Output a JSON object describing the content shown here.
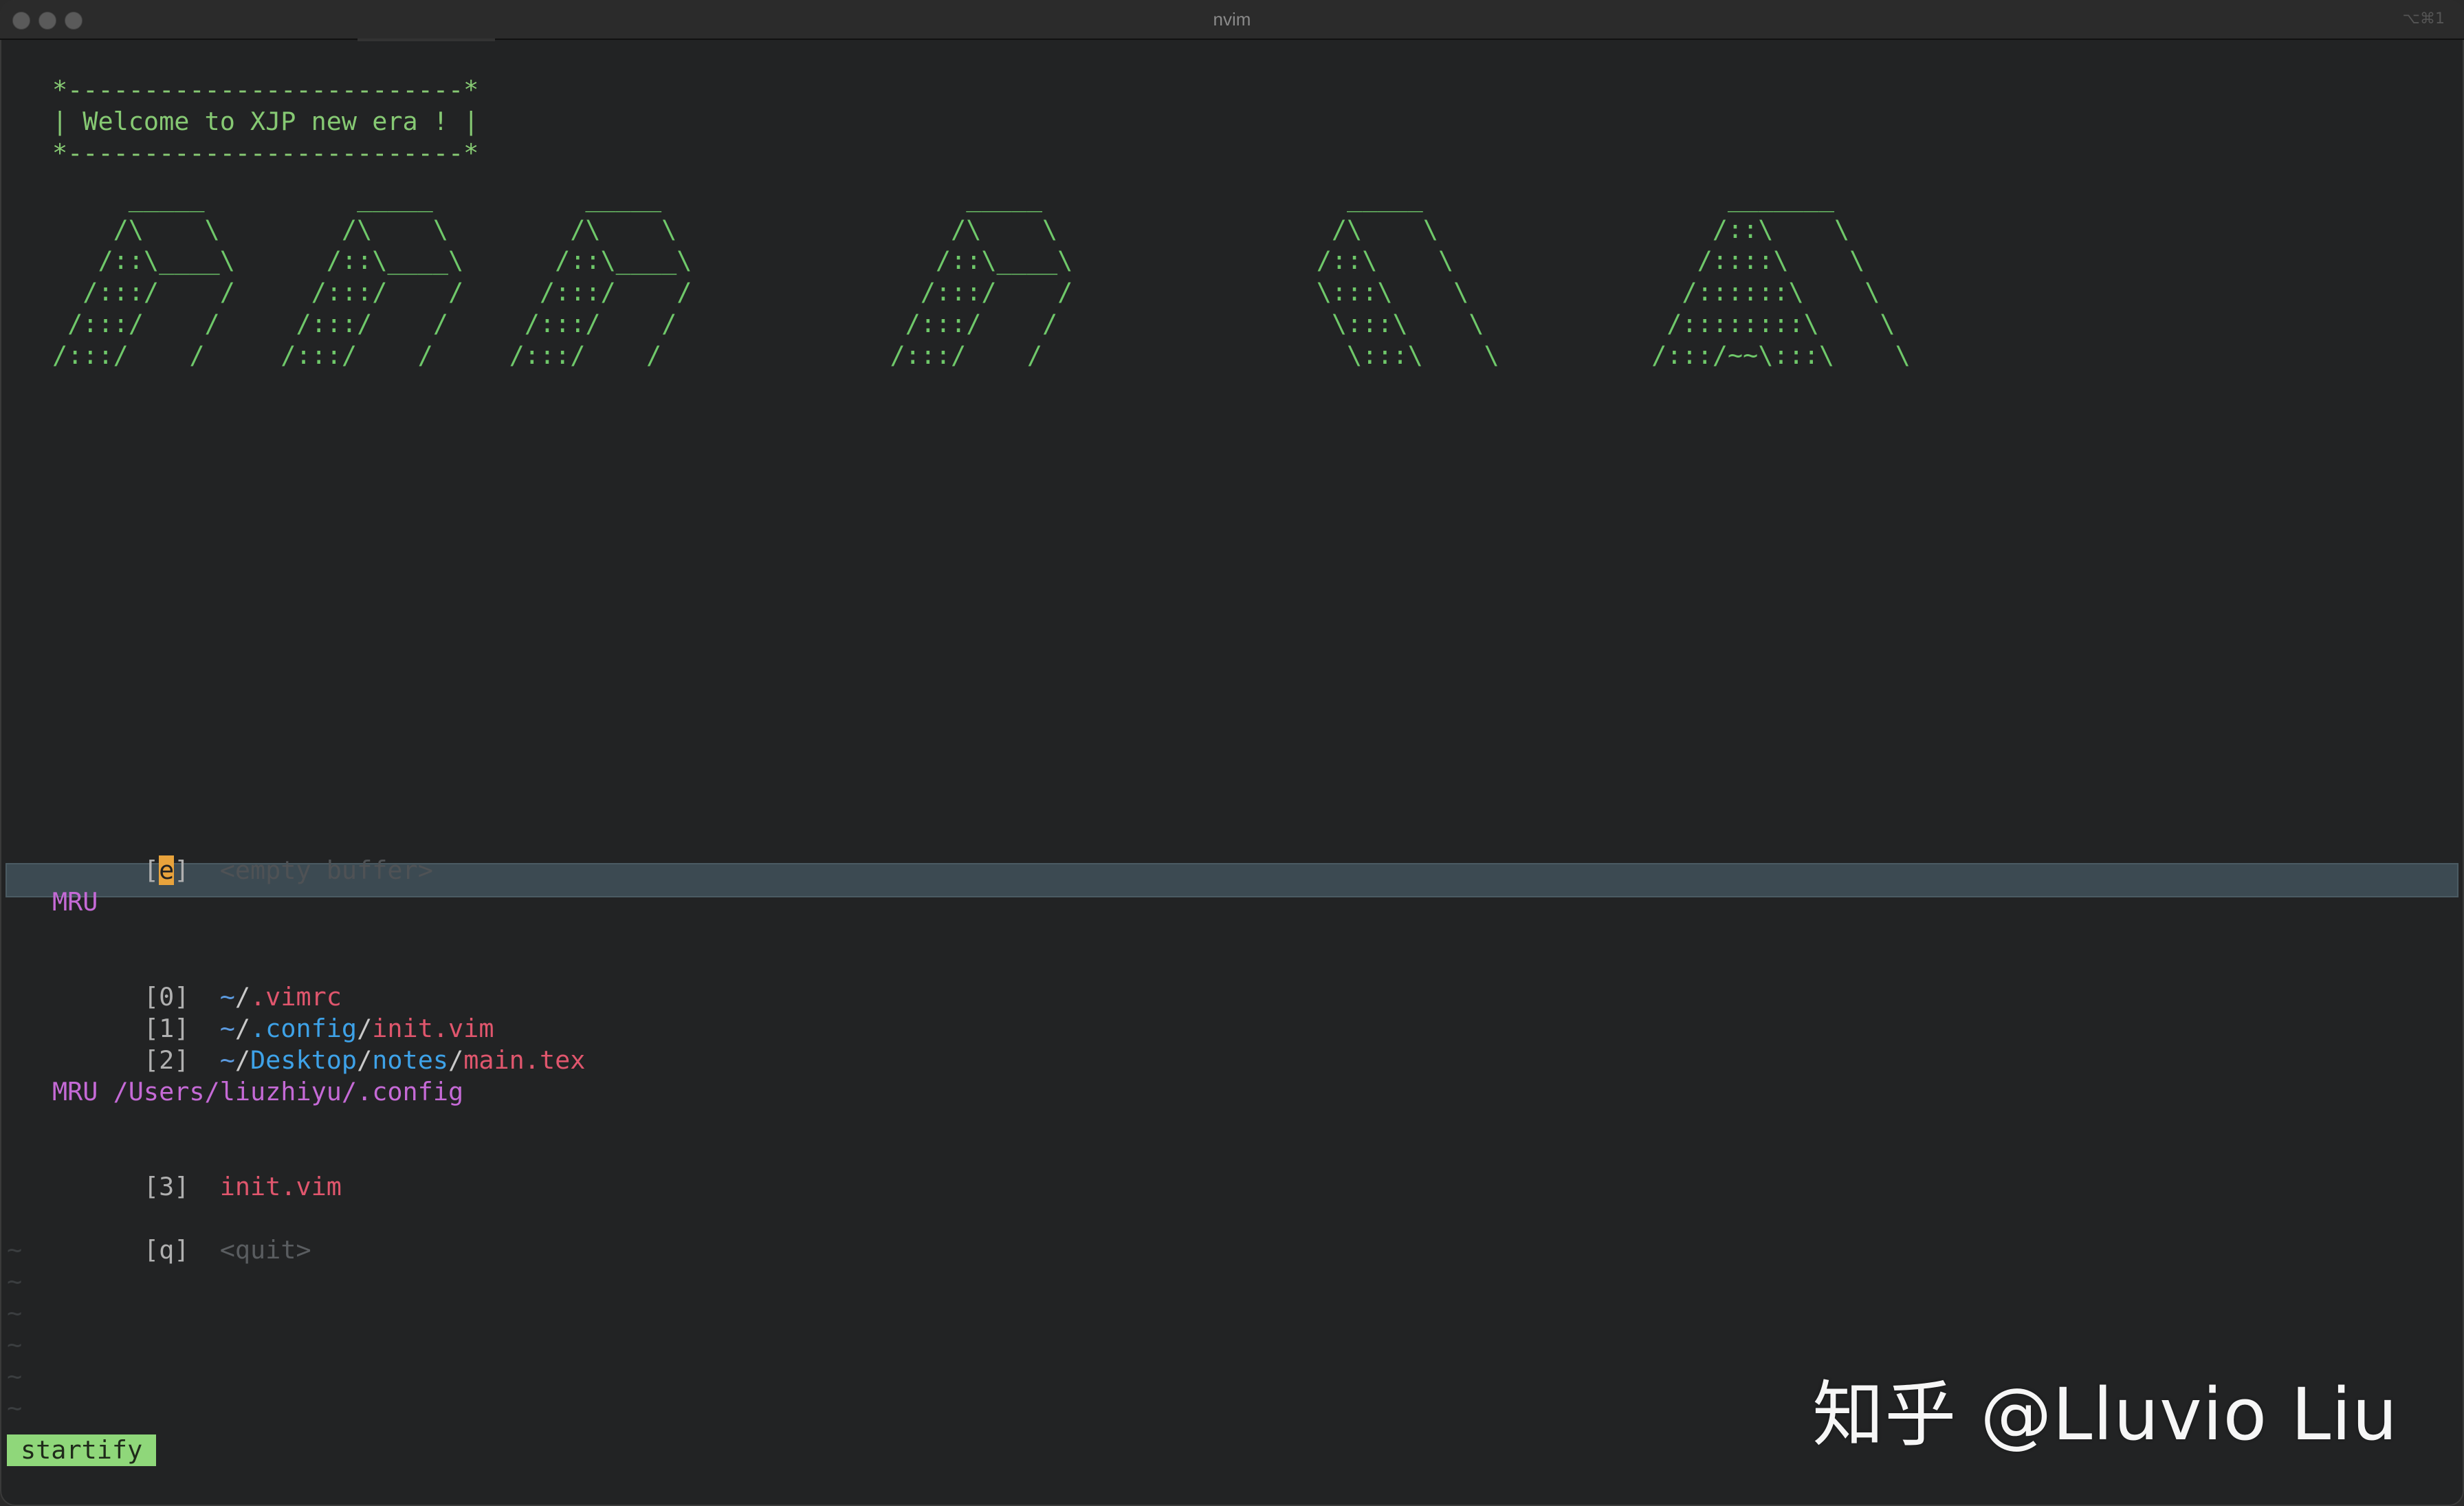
{
  "window": {
    "title": "nvim",
    "shortcut": "⌥⌘1"
  },
  "header_box": {
    "top": "*--------------------------*",
    "middle": "| Welcome to XJP new era ! |",
    "bottom": "*--------------------------*"
  },
  "ascii_art": "     _____          _____          _____                    _____                    _____                    _______\n    /\\    \\        /\\    \\        /\\    \\                  /\\    \\                  /\\    \\                  /::\\    \\\n   /::\\____\\      /::\\____\\      /::\\____\\                /::\\____\\                /::\\    \\                /::::\\    \\\n  /:::/    /     /:::/    /     /:::/    /               /:::/    /                \\:::\\    \\              /::::::\\    \\\n /:::/    /     /:::/    /     /:::/    /               /:::/    /                  \\:::\\    \\            /::::::::\\    \\\n/:::/    /     /:::/    /     /:::/    /               /:::/    /                    \\:::\\    \\          /:::/~~\\:::\\    \\",
  "startify": {
    "empty_buffer": {
      "key_open": "[",
      "key": "e",
      "key_close": "]",
      "label": "<empty buffer>"
    },
    "mru_header": "MRU",
    "mru_items": [
      {
        "index": "[0]",
        "tilde": "~",
        "sep1": "/",
        "dir": "",
        "sep2": "",
        "file": ".vimrc"
      },
      {
        "index": "[1]",
        "tilde": "~",
        "sep1": "/",
        "dir": ".config",
        "sep2": "/",
        "file": "init.vim"
      },
      {
        "index": "[2]",
        "tilde": "~",
        "sep1": "/",
        "dir": "Desktop",
        "sep2": "/",
        "dir2": "notes",
        "sep3": "/",
        "file": "main.tex"
      }
    ],
    "mru_dir_header": "MRU /Users/liuzhiyu/.config",
    "mru_dir_items": [
      {
        "index": "[3]",
        "file": "init.vim"
      }
    ],
    "quit": {
      "index": "[q]",
      "label": "<quit>"
    }
  },
  "statusline": {
    "mode": "startify"
  },
  "watermark": "知乎 @Lluvio Liu",
  "colors": {
    "background": "#222324",
    "ascii_green": "#6fc86a",
    "section_magenta": "#c56ad6",
    "file_red": "#e0566d",
    "dir_blue": "#3ea2e8",
    "cursor_orange": "#e8a33c",
    "statusline_green": "#8fd77a"
  }
}
